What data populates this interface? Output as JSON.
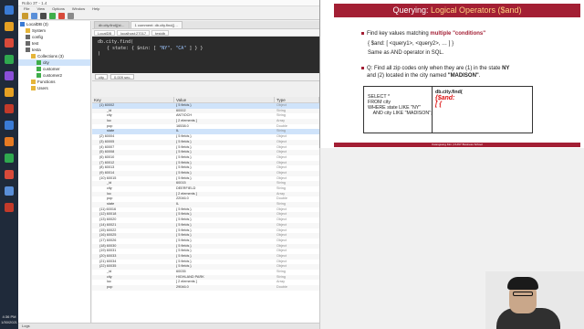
{
  "taskbar": {
    "time": "4:36 PM",
    "date": "1/30/2021",
    "icons": [
      "app-icon",
      "app-icon",
      "app-icon",
      "app-icon",
      "app-icon",
      "app-icon",
      "app-icon",
      "app-icon",
      "app-icon",
      "app-icon",
      "app-icon",
      "app-icon",
      "app-icon"
    ]
  },
  "app": {
    "title": "Robo 3T - 1.4",
    "menu": [
      "File",
      "View",
      "Options",
      "Window",
      "Help"
    ],
    "tabs": [
      "db.city.find({st…",
      "1 comment: db.city.find({…"
    ],
    "conn_chips": [
      "LocalDB",
      "localhost:27017",
      "testdb"
    ],
    "shell_line1": "db.city.find(",
    "shell_line2_pre": "{ state: { $nin: [ ",
    "shell_line2_s1": "\"NY\"",
    "shell_line2_mid": ", ",
    "shell_line2_s2": "\"CA\"",
    "shell_line2_post": " ] } }",
    "shell_line3": ")",
    "result_label": "city",
    "result_time": "0.009 sec.",
    "status_label": "Logs"
  },
  "tree": [
    {
      "label": "LocalDB (3)",
      "indent": 0,
      "icon": "server-icon",
      "sel": false
    },
    {
      "label": "System",
      "indent": 1,
      "icon": "folder-icon",
      "sel": false
    },
    {
      "label": "config",
      "indent": 1,
      "icon": "database-icon",
      "sel": false
    },
    {
      "label": "test",
      "indent": 1,
      "icon": "database-icon",
      "sel": false
    },
    {
      "label": "testa",
      "indent": 1,
      "icon": "database-icon",
      "sel": false
    },
    {
      "label": "Collections (3)",
      "indent": 2,
      "icon": "folder-icon",
      "sel": false
    },
    {
      "label": "city",
      "indent": 3,
      "icon": "collection-icon",
      "sel": true
    },
    {
      "label": "customer",
      "indent": 3,
      "icon": "collection-icon",
      "sel": false
    },
    {
      "label": "customer2",
      "indent": 3,
      "icon": "collection-icon",
      "sel": false
    },
    {
      "label": "Functions",
      "indent": 2,
      "icon": "folder-icon",
      "sel": false
    },
    {
      "label": "Users",
      "indent": 2,
      "icon": "folder-icon",
      "sel": false
    }
  ],
  "grid": {
    "headers": [
      "Key",
      "Value",
      "Type"
    ],
    "rows": [
      [
        "(1) 60002",
        "{ 5 fields }",
        "Object",
        true
      ],
      [
        "_id",
        "60002",
        "String",
        false
      ],
      [
        "city",
        "ANTIOCH",
        "String",
        false
      ],
      [
        "loc",
        "[ 2 elements ]",
        "Array",
        false
      ],
      [
        "pop",
        "16538.0",
        "Double",
        false
      ],
      [
        "state",
        "IL",
        "String",
        true
      ],
      [
        "(2) 60004",
        "{ 5 fields }",
        "Object",
        false
      ],
      [
        "(3) 60005",
        "{ 5 fields }",
        "Object",
        false
      ],
      [
        "(4) 60007",
        "{ 5 fields }",
        "Object",
        false
      ],
      [
        "(5) 60008",
        "{ 5 fields }",
        "Object",
        false
      ],
      [
        "(6) 60010",
        "{ 5 fields }",
        "Object",
        false
      ],
      [
        "(7) 60012",
        "{ 5 fields }",
        "Object",
        false
      ],
      [
        "(8) 60013",
        "{ 5 fields }",
        "Object",
        false
      ],
      [
        "(9) 60014",
        "{ 5 fields }",
        "Object",
        false
      ],
      [
        "(10) 60015",
        "{ 5 fields }",
        "Object",
        false
      ],
      [
        "_id",
        "60015",
        "String",
        false
      ],
      [
        "city",
        "DEERFIELD",
        "String",
        false
      ],
      [
        "loc",
        "[ 2 elements ]",
        "Array",
        false
      ],
      [
        "pop",
        "22046.0",
        "Double",
        false
      ],
      [
        "state",
        "IL",
        "String",
        false
      ],
      [
        "(11) 60016",
        "{ 5 fields }",
        "Object",
        false
      ],
      [
        "(12) 60018",
        "{ 5 fields }",
        "Object",
        false
      ],
      [
        "(13) 60020",
        "{ 5 fields }",
        "Object",
        false
      ],
      [
        "(14) 60021",
        "{ 5 fields }",
        "Object",
        false
      ],
      [
        "(15) 60022",
        "{ 5 fields }",
        "Object",
        false
      ],
      [
        "(16) 60025",
        "{ 5 fields }",
        "Object",
        false
      ],
      [
        "(17) 60026",
        "{ 5 fields }",
        "Object",
        false
      ],
      [
        "(18) 60030",
        "{ 5 fields }",
        "Object",
        false
      ],
      [
        "(19) 60031",
        "{ 5 fields }",
        "Object",
        false
      ],
      [
        "(20) 60033",
        "{ 5 fields }",
        "Object",
        false
      ],
      [
        "(21) 60034",
        "{ 5 fields }",
        "Object",
        false
      ],
      [
        "(22) 60035",
        "{ 5 fields }",
        "Object",
        false
      ],
      [
        "_id",
        "60035",
        "String",
        false
      ],
      [
        "city",
        "HIGHLAND PARK",
        "String",
        false
      ],
      [
        "loc",
        "[ 2 elements ]",
        "Array",
        false
      ],
      [
        "pop",
        "29046.0",
        "Double",
        false
      ]
    ]
  },
  "slide": {
    "title_pre": "Querying: ",
    "title_hl": "Logical Operators ($and)",
    "b1_pre": "Find key values matching ",
    "b1_red1": "multiple",
    "b1_mid": " ",
    "b1_red2": "\"conditions\"",
    "b2_code": "{ $and: [ <query1>, <query2>, … ] }",
    "b3": "Same as AND operator in SQL.",
    "b4_pre": "Q: Find all zip codes only when they are (1) in the state ",
    "b4_bold1": "NY",
    "b4_l2": "and (2) located in the city named ",
    "b4_bold2": "\"MADISON\"",
    "b4_end": ".",
    "sql_left": "SELECT *\nFROM city\nWHERE state LIKE \"NY\"\n    AND city LIKE \"MADISON\";",
    "sql_right": "db.city.find(",
    "ink1": "{$and:",
    "ink2": "[ {",
    "footer": "Kwangsung Kim  |  CUNY Business School"
  }
}
